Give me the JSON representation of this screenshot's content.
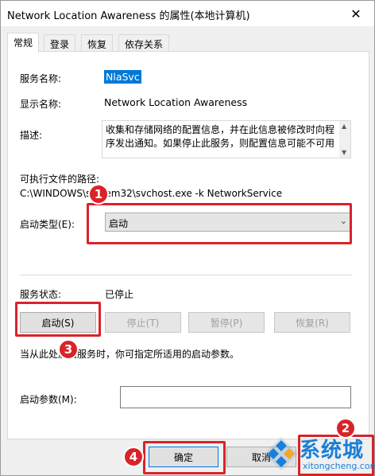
{
  "window": {
    "title": "Network Location Awareness 的属性(本地计算机)",
    "close_glyph": "✕"
  },
  "tabs": [
    {
      "label": "常规"
    },
    {
      "label": "登录"
    },
    {
      "label": "恢复"
    },
    {
      "label": "依存关系"
    }
  ],
  "general": {
    "service_name_label": "服务名称:",
    "service_name_value": "NlaSvc",
    "display_name_label": "显示名称:",
    "display_name_value": "Network Location Awareness",
    "description_label": "描述:",
    "description_value": "收集和存储网络的配置信息，并在此信息被修改时向程序发出通知。如果停止此服务，则配置信息可能不可用",
    "exec_path_label": "可执行文件的路径:",
    "exec_path_value": "C:\\WINDOWS\\system32\\svchost.exe -k NetworkService",
    "startup_type_label": "启动类型(E):",
    "startup_type_value": "启动",
    "service_status_label": "服务状态:",
    "service_status_value": "已停止",
    "buttons": {
      "start": "启动(S)",
      "stop": "停止(T)",
      "pause": "暂停(P)",
      "resume": "恢复(R)"
    },
    "hint_text": "当从此处启动服务时，你可指定所适用的启动参数。",
    "start_params_label": "启动参数(M):",
    "start_params_value": ""
  },
  "footer": {
    "ok": "确定",
    "cancel": "取消"
  },
  "annotations": {
    "marker_1": "1",
    "marker_2": "2",
    "marker_3": "3",
    "marker_4": "4",
    "highlight_color": "#d9232a"
  },
  "watermark": {
    "cn_text": "系统城",
    "en_text": "xitongcheng.com",
    "color": "#1a7fd6"
  }
}
